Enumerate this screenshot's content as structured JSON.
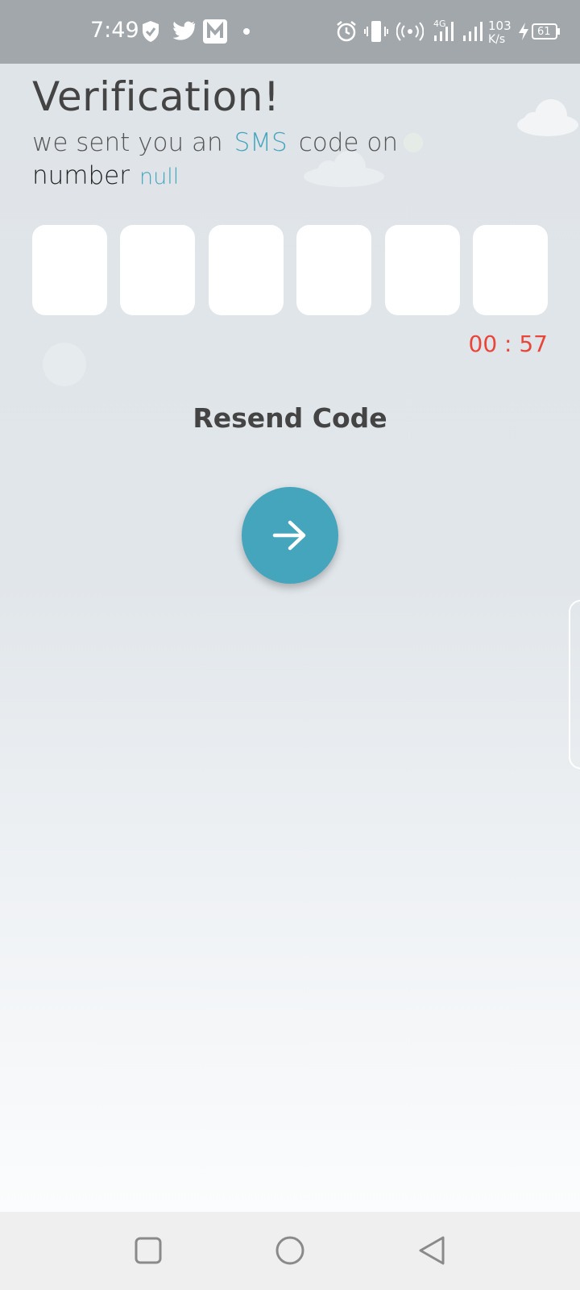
{
  "status_bar": {
    "time": "7:49",
    "network_type": "4G",
    "speed_value": "103",
    "speed_unit": "K/s",
    "battery": "61",
    "icons": [
      "shield-icon",
      "twitter-icon",
      "m-app-icon",
      "dot-icon",
      "alarm-icon",
      "vibrate-icon",
      "hotspot-icon",
      "signal-icon",
      "signal-icon",
      "charging-icon",
      "battery-icon"
    ]
  },
  "verification": {
    "title": "Verification!",
    "subtitle_prefix": "we sent you an",
    "subtitle_accent": "SMS",
    "subtitle_suffix": "code on",
    "number_label": "number",
    "number_value": "null",
    "otp_digits": [
      "",
      "",
      "",
      "",
      "",
      ""
    ],
    "timer": "00 : 57",
    "resend_label": "Resend Code",
    "next_icon": "arrow-right-icon"
  },
  "nav_bar": {
    "icons": [
      "recents-square-icon",
      "home-circle-icon",
      "back-triangle-icon"
    ]
  },
  "colors": {
    "accent": "#45a5bd",
    "timer": "#e8463b",
    "title": "#444444",
    "status_bar": "#a2a7ab",
    "nav_bar": "#efefef"
  }
}
